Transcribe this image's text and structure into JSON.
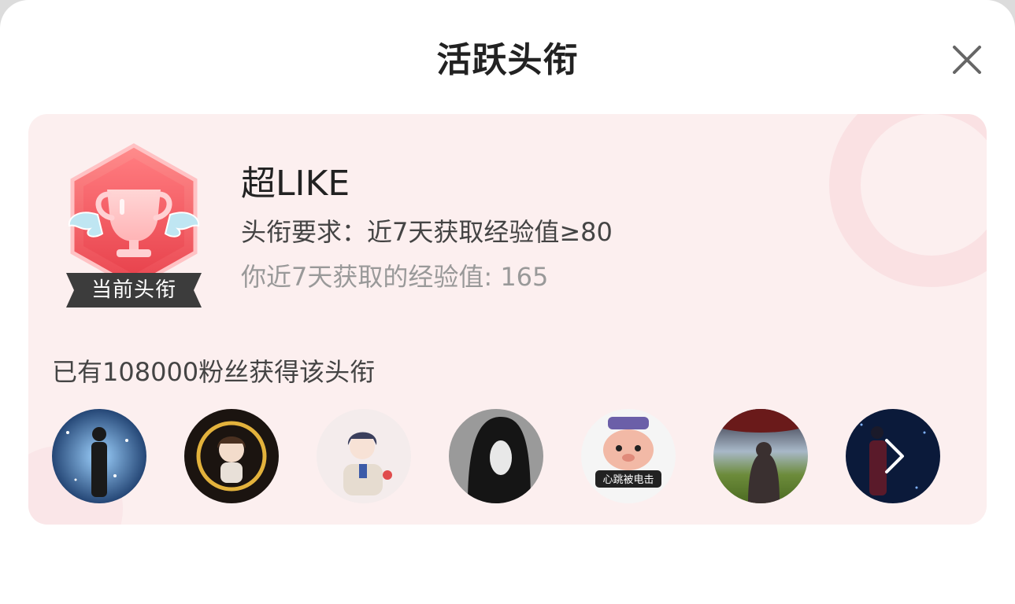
{
  "header": {
    "title": "活跃头衔",
    "close_icon": "close-icon"
  },
  "title_card": {
    "badge": {
      "icon": "trophy-wings-icon",
      "label": "当前头衔",
      "color": "#f0555f"
    },
    "name": "超LIKE",
    "requirement": "头衔要求：近7天获取经验值≥80",
    "my_progress": "你近7天获取的经验值: 165",
    "fans_text": "已有108000粉丝获得该头衔",
    "avatars": [
      {
        "name": "avatar-1"
      },
      {
        "name": "avatar-2"
      },
      {
        "name": "avatar-3"
      },
      {
        "name": "avatar-4"
      },
      {
        "name": "avatar-5",
        "caption": "心跳被电击"
      },
      {
        "name": "avatar-6"
      },
      {
        "name": "avatar-7"
      }
    ],
    "more_icon": "chevron-right-icon"
  },
  "colors": {
    "card_bg": "#fcefef",
    "accent": "#f0555f",
    "text_primary": "#222222",
    "text_secondary": "#444444",
    "text_muted": "#999999"
  }
}
